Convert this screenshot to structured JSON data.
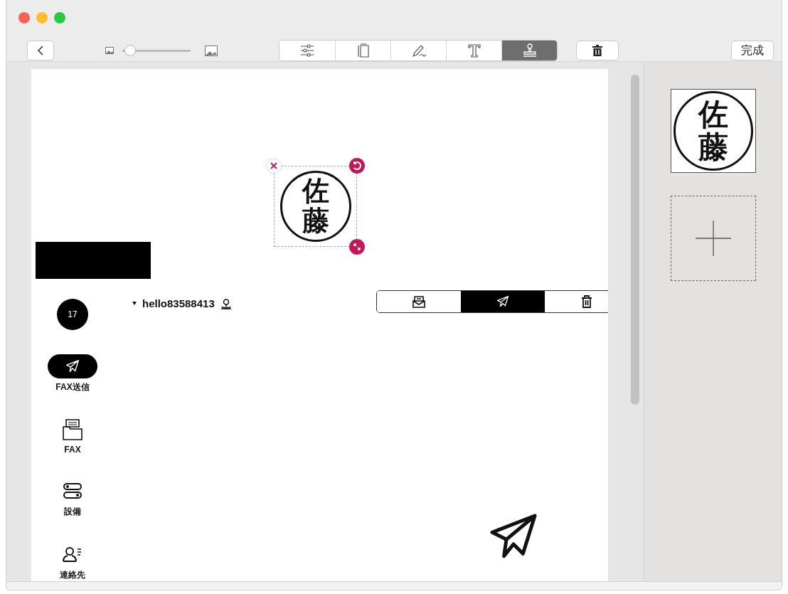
{
  "toolbar": {
    "zoom_slider": {
      "level": 0.08
    },
    "tools": [
      {
        "kind": "adjust",
        "selected": false
      },
      {
        "kind": "pages",
        "selected": false
      },
      {
        "kind": "sign",
        "selected": false
      },
      {
        "kind": "text",
        "selected": false
      },
      {
        "kind": "stamp",
        "selected": true
      }
    ],
    "done_button": "完成"
  },
  "document": {
    "placed_stamp": {
      "text": "佐藤"
    },
    "page": {
      "badge": "17",
      "account": "hello83588413",
      "segments": [
        {
          "kind": "inbox",
          "selected": false
        },
        {
          "kind": "send",
          "selected": true
        },
        {
          "kind": "trash",
          "selected": false
        }
      ],
      "nav": [
        {
          "kind": "send",
          "label": "FAX送信",
          "selected": true
        },
        {
          "kind": "fax",
          "label": "FAX",
          "selected": false
        },
        {
          "kind": "devices",
          "label": "設備",
          "selected": false
        },
        {
          "kind": "contacts",
          "label": "連絡先",
          "selected": false
        }
      ]
    }
  },
  "stamps_panel": {
    "stamps": [
      {
        "text": "佐藤"
      }
    ]
  }
}
